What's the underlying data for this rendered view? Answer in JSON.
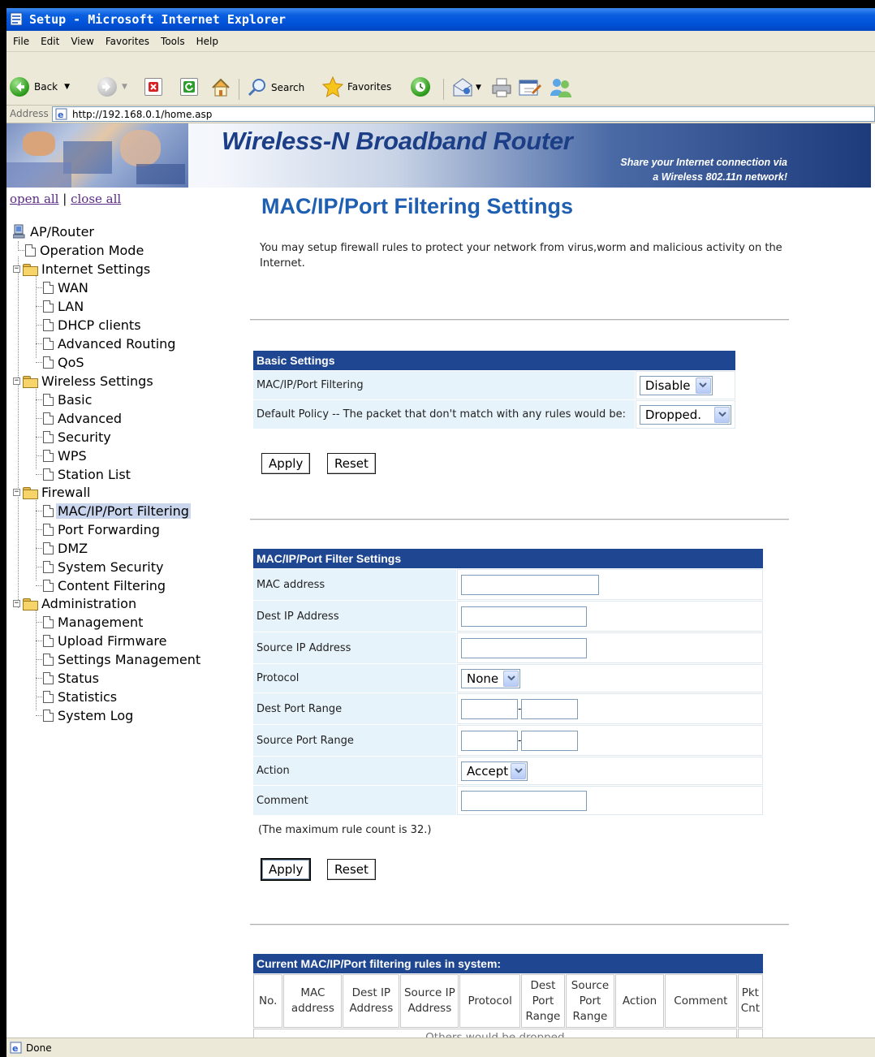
{
  "window": {
    "title": "Setup - Microsoft Internet Explorer"
  },
  "menu": [
    "File",
    "Edit",
    "View",
    "Favorites",
    "Tools",
    "Help"
  ],
  "toolbar": {
    "back": "Back",
    "search": "Search",
    "favorites": "Favorites"
  },
  "address": {
    "label": "Address",
    "url": "http://192.168.0.1/home.asp"
  },
  "banner": {
    "brand": "Wireless-N Broadband Router",
    "tag_line1": "Share your Internet connection via",
    "tag_line2": "a Wireless 802.11n network!"
  },
  "tree": {
    "open_all": "open all",
    "close_all": "close all",
    "separator": "|",
    "root": "AP/Router",
    "items": [
      {
        "label": "Operation Mode"
      },
      {
        "label": "Internet Settings"
      },
      {
        "label": "WAN"
      },
      {
        "label": "LAN"
      },
      {
        "label": "DHCP clients"
      },
      {
        "label": "Advanced Routing"
      },
      {
        "label": "QoS"
      },
      {
        "label": "Wireless Settings"
      },
      {
        "label": "Basic"
      },
      {
        "label": "Advanced"
      },
      {
        "label": "Security"
      },
      {
        "label": "WPS"
      },
      {
        "label": "Station List"
      },
      {
        "label": "Firewall"
      },
      {
        "label": "MAC/IP/Port Filtering"
      },
      {
        "label": "Port Forwarding"
      },
      {
        "label": "DMZ"
      },
      {
        "label": "System Security"
      },
      {
        "label": "Content Filtering"
      },
      {
        "label": "Administration"
      },
      {
        "label": "Management"
      },
      {
        "label": "Upload Firmware"
      },
      {
        "label": "Settings Management"
      },
      {
        "label": "Status"
      },
      {
        "label": "Statistics"
      },
      {
        "label": "System Log"
      }
    ],
    "selected": "MAC/IP/Port Filtering"
  },
  "content": {
    "title": "MAC/IP/Port Filtering Settings",
    "intro": "You may setup firewall rules to protect your network from virus,worm and malicious activity on the Internet.",
    "basic": {
      "header": "Basic Settings",
      "filtering_label": "MAC/IP/Port Filtering",
      "filtering_value": "Disable",
      "policy_label": "Default Policy -- The packet that don't match with any rules would be:",
      "policy_value": "Dropped."
    },
    "apply": "Apply",
    "reset": "Reset",
    "filter": {
      "header": "MAC/IP/Port Filter Settings",
      "mac_label": "MAC address",
      "dest_ip_label": "Dest IP Address",
      "src_ip_label": "Source IP Address",
      "protocol_label": "Protocol",
      "protocol_value": "None",
      "dest_port_label": "Dest Port Range",
      "src_port_label": "Source Port Range",
      "range_sep": "-",
      "action_label": "Action",
      "action_value": "Accept",
      "comment_label": "Comment"
    },
    "max_note": "(The maximum rule count is 32.)",
    "rules": {
      "header": "Current MAC/IP/Port filtering rules in system:",
      "columns": [
        "No.",
        "MAC address",
        "Dest IP Address",
        "Source IP Address",
        "Protocol",
        "Dest Port Range",
        "Source Port Range",
        "Action",
        "Comment",
        "Pkt Cnt"
      ],
      "others": "Others would be dropped"
    }
  },
  "status": {
    "text": "Done"
  },
  "colors": {
    "header_blue": "#1f4690",
    "title_blue": "#1f5fb2",
    "label_bg": "#e6f3fb",
    "xp_title": "#0a5fe0"
  }
}
